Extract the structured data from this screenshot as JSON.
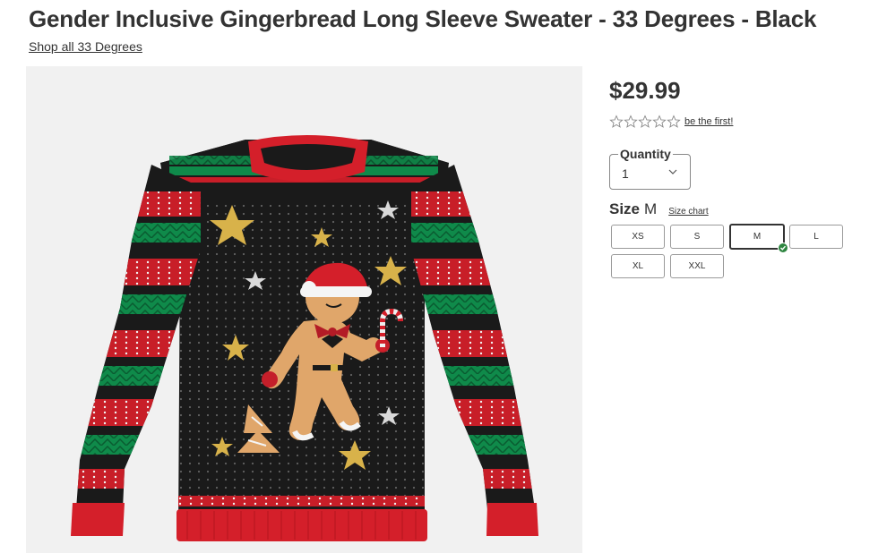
{
  "product": {
    "title": "Gender Inclusive Gingerbread Long Sleeve Sweater - 33 Degrees - Black",
    "brand_link": "Shop all 33 Degrees",
    "price": "$29.99"
  },
  "rating": {
    "stars_filled": 0,
    "stars_total": 5,
    "link_text": "be the first!"
  },
  "quantity": {
    "label": "Quantity",
    "value": "1",
    "icon": "chevron-down-icon"
  },
  "size": {
    "label": "Size",
    "selected": "M",
    "chart_link": "Size chart",
    "options": [
      "XS",
      "S",
      "M",
      "L",
      "XL",
      "XXL"
    ]
  },
  "colors": {
    "text": "#333333",
    "selected_check": "#2e8540",
    "image_background": "#f1f1f1",
    "sweater_red": "#d41f2a",
    "sweater_green": "#0f8a4a",
    "sweater_black": "#1a1a1a"
  }
}
